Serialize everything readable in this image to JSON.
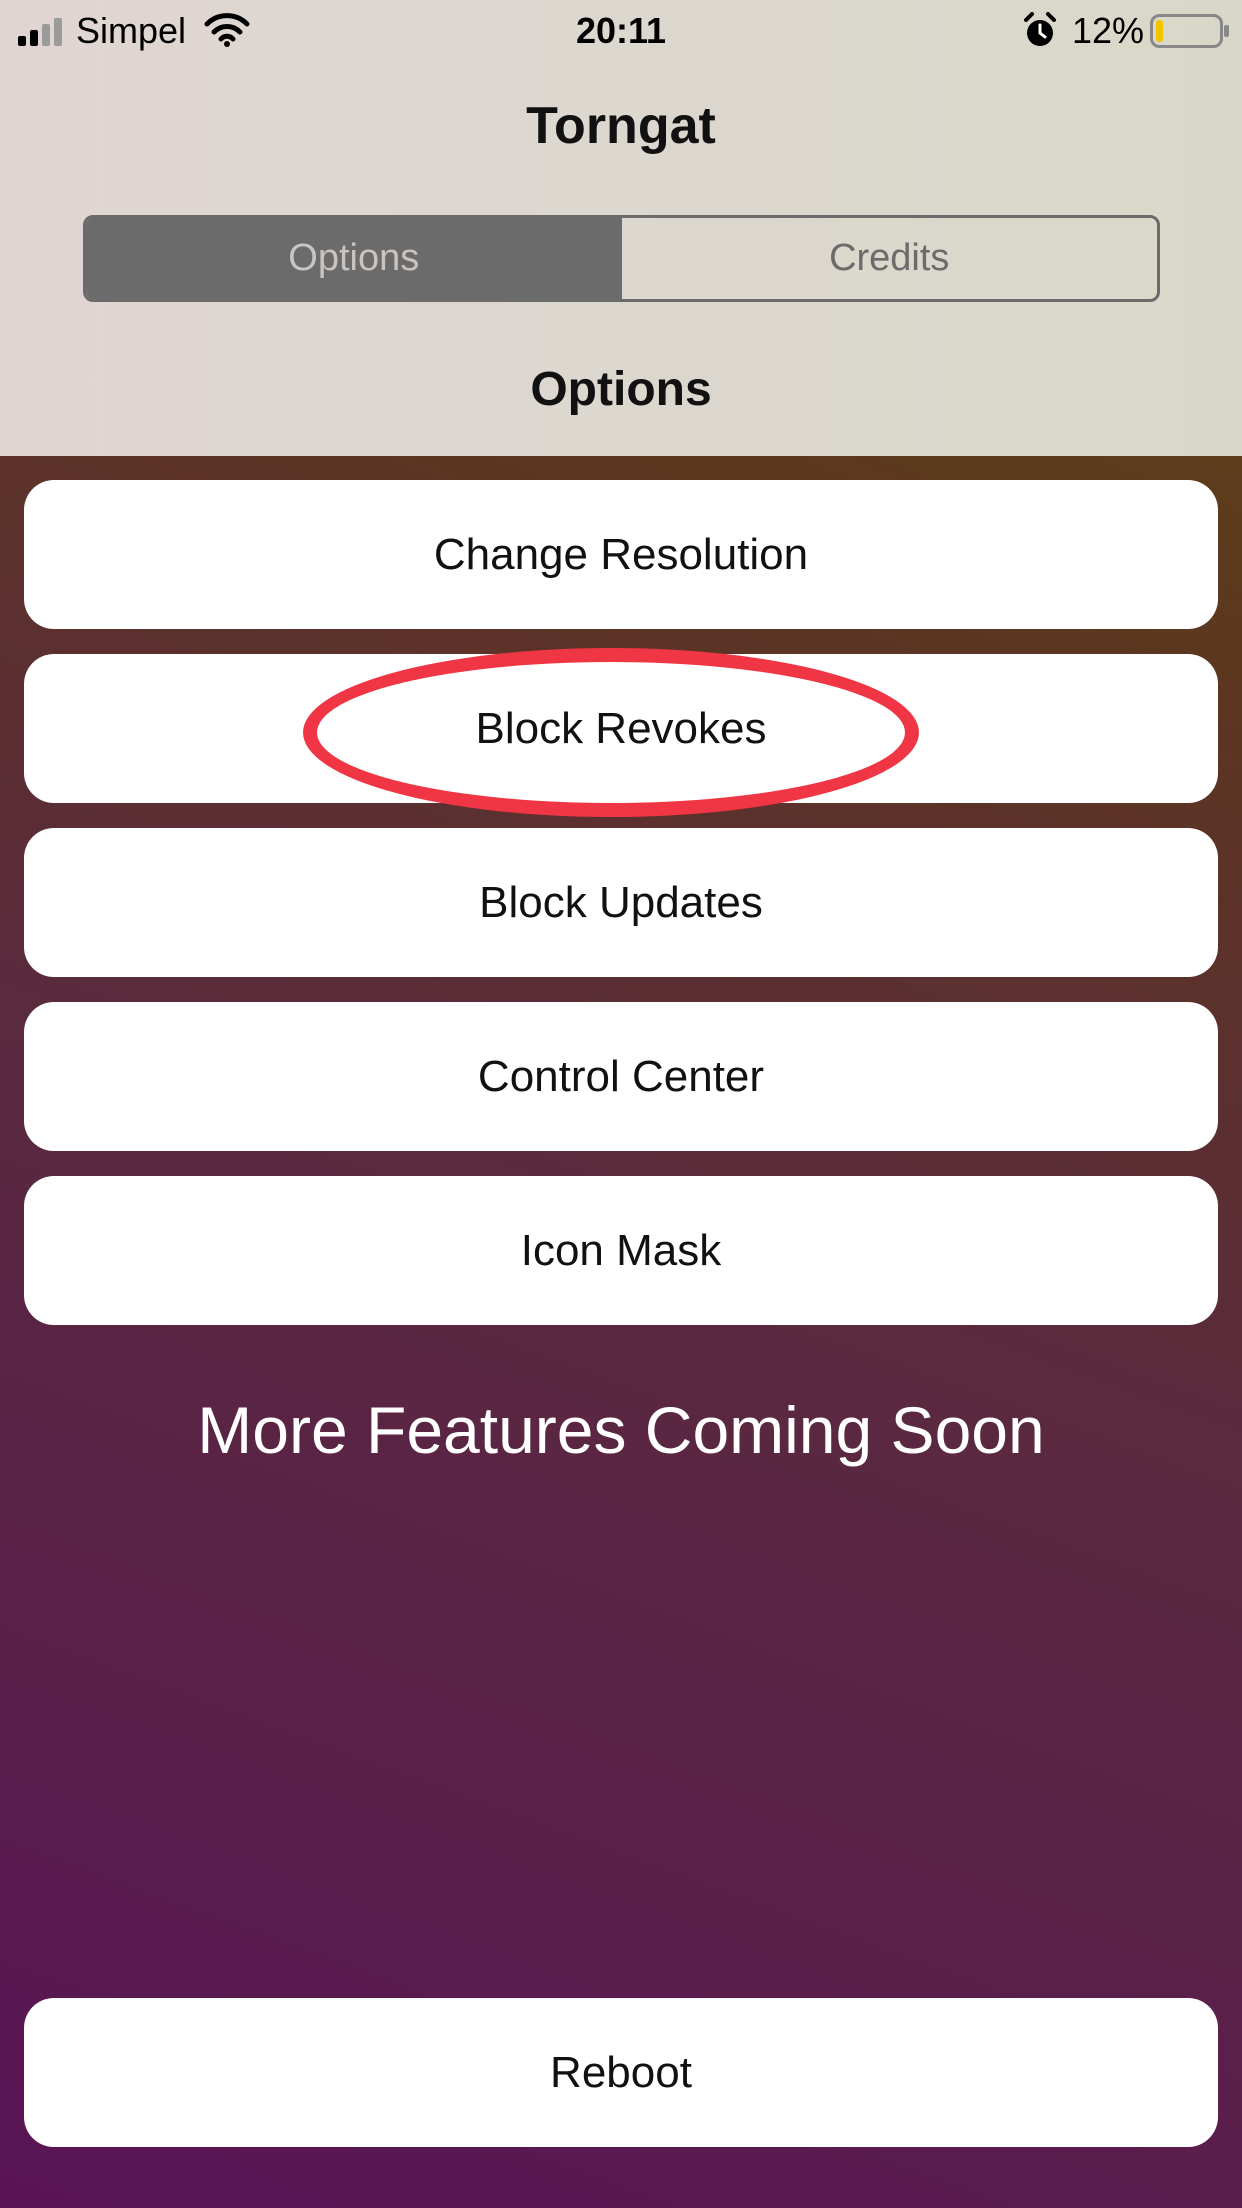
{
  "status_bar": {
    "carrier": "Simpel",
    "time": "20:11",
    "battery_percent": "12%",
    "battery_level": 0.12,
    "icons": [
      "signal-icon",
      "wifi-icon",
      "alarm-icon",
      "battery-icon"
    ]
  },
  "app": {
    "title": "Torngat"
  },
  "tabs": [
    {
      "label": "Options",
      "selected": true
    },
    {
      "label": "Credits",
      "selected": false
    }
  ],
  "section": {
    "title": "Options"
  },
  "options": [
    {
      "label": "Change Resolution"
    },
    {
      "label": "Block Revokes",
      "highlighted": true
    },
    {
      "label": "Block Updates"
    },
    {
      "label": "Control Center"
    },
    {
      "label": "Icon Mask"
    }
  ],
  "footer_text": "More Features Coming Soon",
  "reboot": {
    "label": "Reboot"
  },
  "colors": {
    "highlight_ring": "#f03645",
    "segment_active": "#6b6b6b",
    "battery_fill": "#f5c400",
    "gradient_purple": "#5a1456",
    "gradient_olive": "#5c4a10"
  }
}
